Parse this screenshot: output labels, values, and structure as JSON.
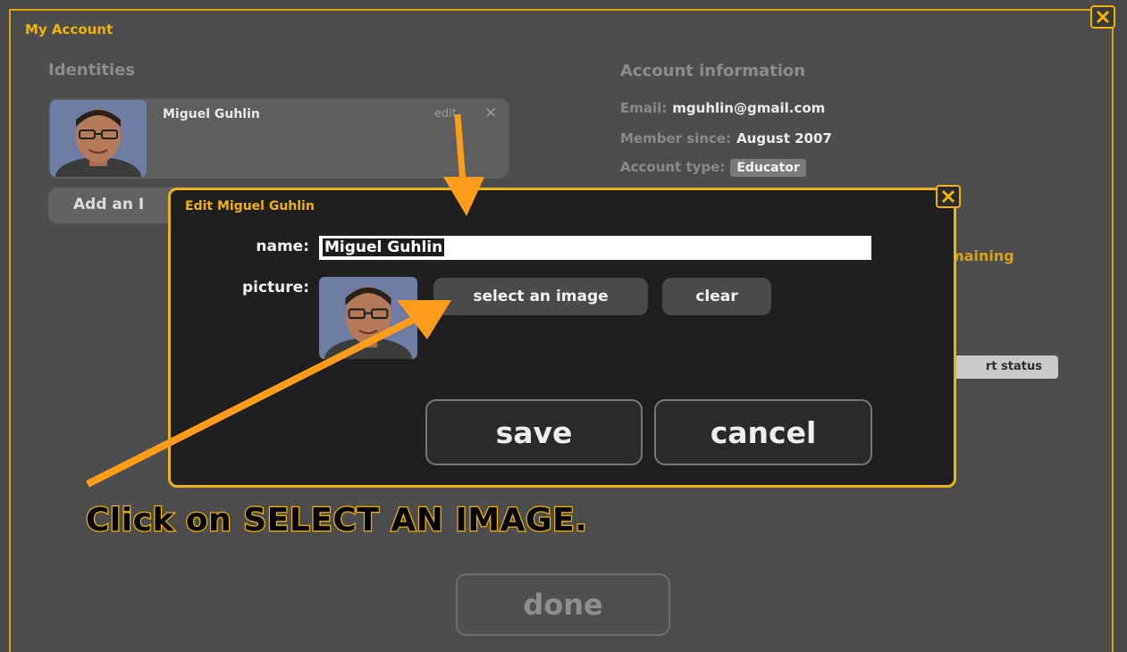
{
  "window": {
    "title": "My Account",
    "close_icon": "close-icon"
  },
  "identities": {
    "heading": "Identities",
    "items": [
      {
        "name": "Miguel Guhlin",
        "edit_label": "edit",
        "remove_icon": "x-icon"
      }
    ],
    "add_button_label": "Add an I"
  },
  "account": {
    "heading": "Account information",
    "email_label": "Email:",
    "email_value": "mguhlin@gmail.com",
    "member_label": "Member since:",
    "member_value": "August 2007",
    "type_label": "Account type:",
    "type_value": "Educator"
  },
  "partial": {
    "remaining": "maining",
    "status_button": "rt status"
  },
  "done_label": "done",
  "dialog": {
    "title": "Edit Miguel Guhlin",
    "name_label": "name:",
    "name_value": "Miguel Guhlin",
    "picture_label": "picture:",
    "select_image_label": "select an image",
    "clear_label": "clear",
    "save_label": "save",
    "cancel_label": "cancel"
  },
  "instruction": "Click on SELECT AN IMAGE.",
  "colors": {
    "accent": "#f0b400",
    "dialog_bg": "#1f1f1f",
    "window_bg": "#4d4d4d",
    "arrow": "#ff9c1a"
  }
}
